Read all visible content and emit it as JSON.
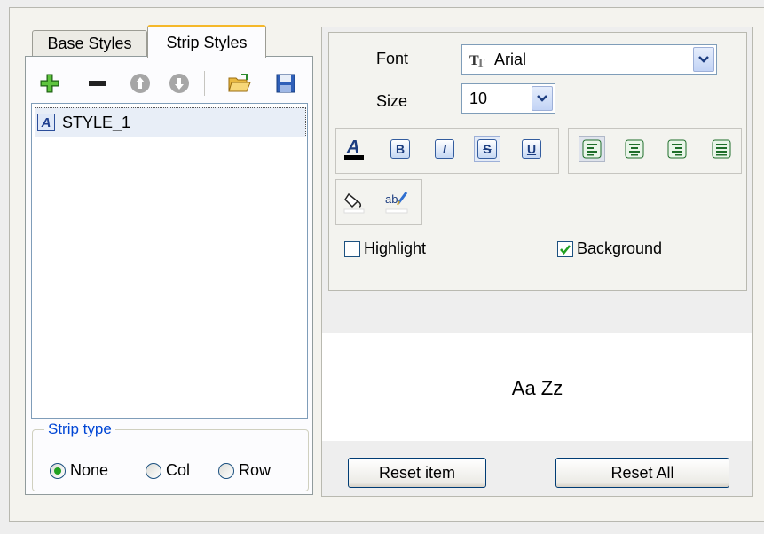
{
  "tabs": [
    {
      "label": "Base Styles",
      "active": false
    },
    {
      "label": "Strip Styles",
      "active": true
    }
  ],
  "toolbar": {
    "icons": [
      "add-icon",
      "remove-icon",
      "move-up-icon",
      "move-down-icon",
      "open-folder-icon",
      "save-icon"
    ]
  },
  "styles_list": {
    "items": [
      {
        "label": "STYLE_1",
        "selected": true
      }
    ]
  },
  "strip_type": {
    "legend": "Strip type",
    "options": [
      {
        "label": "None",
        "checked": true
      },
      {
        "label": "Col",
        "checked": false
      },
      {
        "label": "Row",
        "checked": false
      }
    ]
  },
  "font": {
    "font_label": "Font",
    "font_value": "Arial",
    "size_label": "Size",
    "size_value": "10",
    "format_buttons": [
      "font-color",
      "bold",
      "italic",
      "strikeout",
      "underline"
    ],
    "format_glyphs": {
      "bold": "B",
      "italic": "I",
      "strikeout": "S",
      "underline": "U"
    },
    "align_buttons": [
      "align-left",
      "align-center",
      "align-right",
      "align-justify"
    ],
    "color_buttons": [
      "fill-color",
      "text-color"
    ]
  },
  "checkboxes": {
    "highlight": {
      "label": "Highlight",
      "checked": false
    },
    "background": {
      "label": "Background",
      "checked": true
    }
  },
  "preview": {
    "text": "Aa Zz"
  },
  "buttons": {
    "reset_item": "Reset item",
    "reset_all": "Reset All"
  },
  "colors": {
    "accent_tab": "#f5b82a",
    "legend_text": "#0046d5",
    "radio_dot": "#21a121",
    "check_mark": "#21a121",
    "button_border": "#003c74"
  }
}
